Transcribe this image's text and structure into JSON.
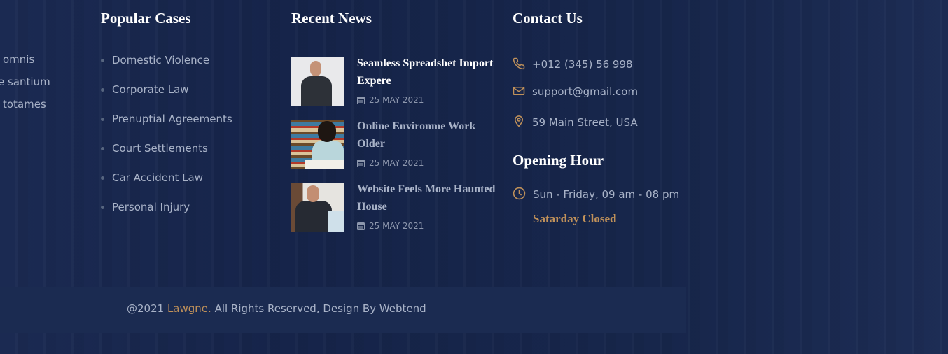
{
  "colors": {
    "background": "#17254a",
    "accent": "#c0915a",
    "text": "#a9b3c8",
    "bottom_bar": "#1b2b51"
  },
  "left_column": {
    "items": [
      "omnis",
      "e santium",
      "totames"
    ]
  },
  "popular_cases": {
    "title": "Popular Cases",
    "items": [
      "Domestic Violence",
      "Corporate Law",
      "Prenuptial Agreements",
      "Court Settlements",
      "Car Accident Law",
      "Personal Injury"
    ]
  },
  "recent_news": {
    "title": "Recent News",
    "items": [
      {
        "title": "Seamless Spreadshet Import Expere",
        "date": "25 MAY 2021",
        "icon": "calendar-icon"
      },
      {
        "title": "Online Environme Work Older",
        "date": "25 MAY 2021",
        "icon": "calendar-icon"
      },
      {
        "title": "Website Feels More Haunted House",
        "date": "25 MAY 2021",
        "icon": "calendar-icon"
      }
    ]
  },
  "contact": {
    "title": "Contact Us",
    "phone": "+012 (345) 56 998",
    "email": "support@gmail.com",
    "address": "59 Main Street, USA"
  },
  "opening": {
    "title": "Opening Hour",
    "hours": "Sun - Friday, 09 am - 08 pm",
    "closed": "Satarday Closed"
  },
  "footer": {
    "prefix": "@2021 ",
    "brand": "Lawgne.",
    "suffix": " All Rights Reserved, Design By Webtend"
  }
}
